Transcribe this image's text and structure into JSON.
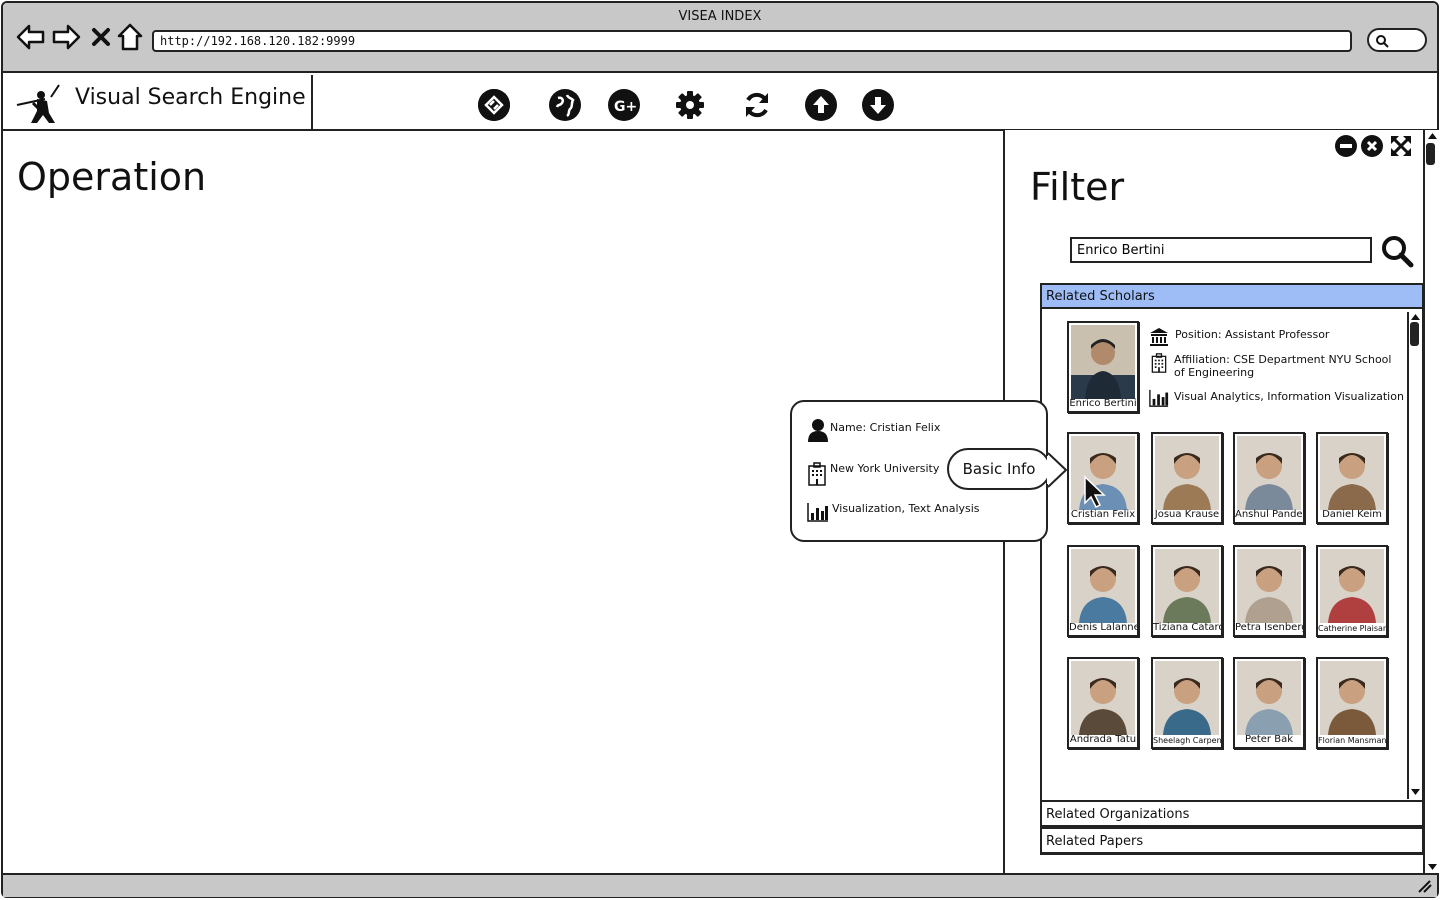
{
  "browser": {
    "window_title": "VISEA INDEX",
    "url": "http://192.168.120.182:9999"
  },
  "header": {
    "brand_name": "Visual Search Engine",
    "toolbar": [
      {
        "id": "link",
        "icon": "link-icon"
      },
      {
        "id": "globe",
        "icon": "globe-icon"
      },
      {
        "id": "google",
        "icon": "google-plus-icon"
      },
      {
        "id": "settings",
        "icon": "gear-icon"
      },
      {
        "id": "refresh",
        "icon": "refresh-icon"
      },
      {
        "id": "up",
        "icon": "arrow-up-icon"
      },
      {
        "id": "down",
        "icon": "arrow-down-icon"
      }
    ]
  },
  "operation": {
    "title": "Operation"
  },
  "filter": {
    "title": "Filter",
    "search_value": "Enrico Bertini",
    "sections": {
      "scholars": "Related Scholars",
      "organizations": "Related Organizations",
      "papers": "Related Papers"
    },
    "main_scholar": {
      "name": "Enrico Bertini",
      "position": "Position: Assistant Professor",
      "affiliation": "Affiliation: CSE Department NYU School of Engineering",
      "interests": "Visual Analytics, Information Visualization"
    },
    "scholars": [
      {
        "name": "Cristian Felix",
        "color": "#6b8fb5"
      },
      {
        "name": "Josua Krause",
        "color": "#9c7a55"
      },
      {
        "name": "Anshul Pandey",
        "color": "#7a8a9a"
      },
      {
        "name": "Daniel Keim",
        "color": "#8a6a4a"
      },
      {
        "name": "Denis Lalanne",
        "color": "#4a7aa0"
      },
      {
        "name": "Tiziana Catarci",
        "color": "#6a7a5a"
      },
      {
        "name": "Petra Isenberg",
        "color": "#b0a090"
      },
      {
        "name": "Catherine Plaisant",
        "color": "#b04040"
      },
      {
        "name": "Andrada Tatu",
        "color": "#5a4a3a"
      },
      {
        "name": "Sheelagh Carpendale",
        "color": "#3a6a8a"
      },
      {
        "name": "Peter Bak",
        "color": "#8aa0b0"
      },
      {
        "name": "Florian Mansmann",
        "color": "#7a5a3a"
      }
    ]
  },
  "tooltip": {
    "name": "Name: Cristian Felix",
    "organization": "New York University",
    "interests": "Visualization, Text Analysis",
    "button": "Basic Info"
  },
  "colors": {
    "chrome": "#c8c8c8",
    "accordion_active": "#9ebdf7",
    "ink": "#111111"
  }
}
